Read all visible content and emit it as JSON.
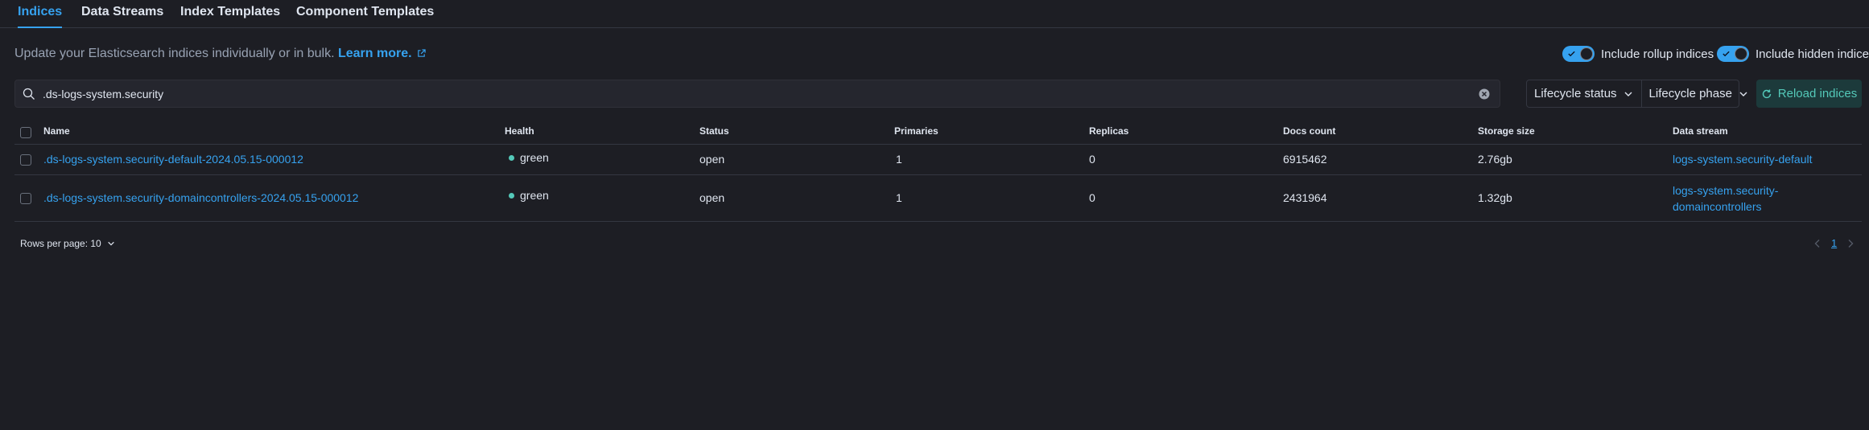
{
  "tabs": [
    {
      "label": "Indices",
      "active": true
    },
    {
      "label": "Data Streams",
      "active": false
    },
    {
      "label": "Index Templates",
      "active": false
    },
    {
      "label": "Component Templates",
      "active": false
    }
  ],
  "description": {
    "text": "Update your Elasticsearch indices individually or in bulk.",
    "learn_more": "Learn more."
  },
  "toggles": {
    "rollup": {
      "label": "Include rollup indices",
      "checked": true
    },
    "hidden": {
      "label": "Include hidden indices",
      "checked": true
    }
  },
  "search": {
    "value": ".ds-logs-system.security",
    "icon": "search-icon"
  },
  "filters": {
    "lifecycle_status": "Lifecycle status",
    "lifecycle_phase": "Lifecycle phase"
  },
  "reload_label": "Reload indices",
  "table": {
    "columns": [
      "Name",
      "Health",
      "Status",
      "Primaries",
      "Replicas",
      "Docs count",
      "Storage size",
      "Data stream"
    ],
    "rows": [
      {
        "name": ".ds-logs-system.security-default-2024.05.15-000012",
        "health": "green",
        "status": "open",
        "primaries": "1",
        "replicas": "0",
        "docs_count": "6915462",
        "storage_size": "2.76gb",
        "data_stream": "logs-system.security-default"
      },
      {
        "name": ".ds-logs-system.security-domaincontrollers-2024.05.15-000012",
        "health": "green",
        "status": "open",
        "primaries": "1",
        "replicas": "0",
        "docs_count": "2431964",
        "storage_size": "1.32gb",
        "data_stream": "logs-system.security-domaincontrollers"
      }
    ]
  },
  "footer": {
    "rows_per_page": "Rows per page: 10",
    "current_page": "1"
  },
  "colors": {
    "accent": "#36a2ef",
    "success": "#54c9b9",
    "background": "#1d1e24"
  }
}
